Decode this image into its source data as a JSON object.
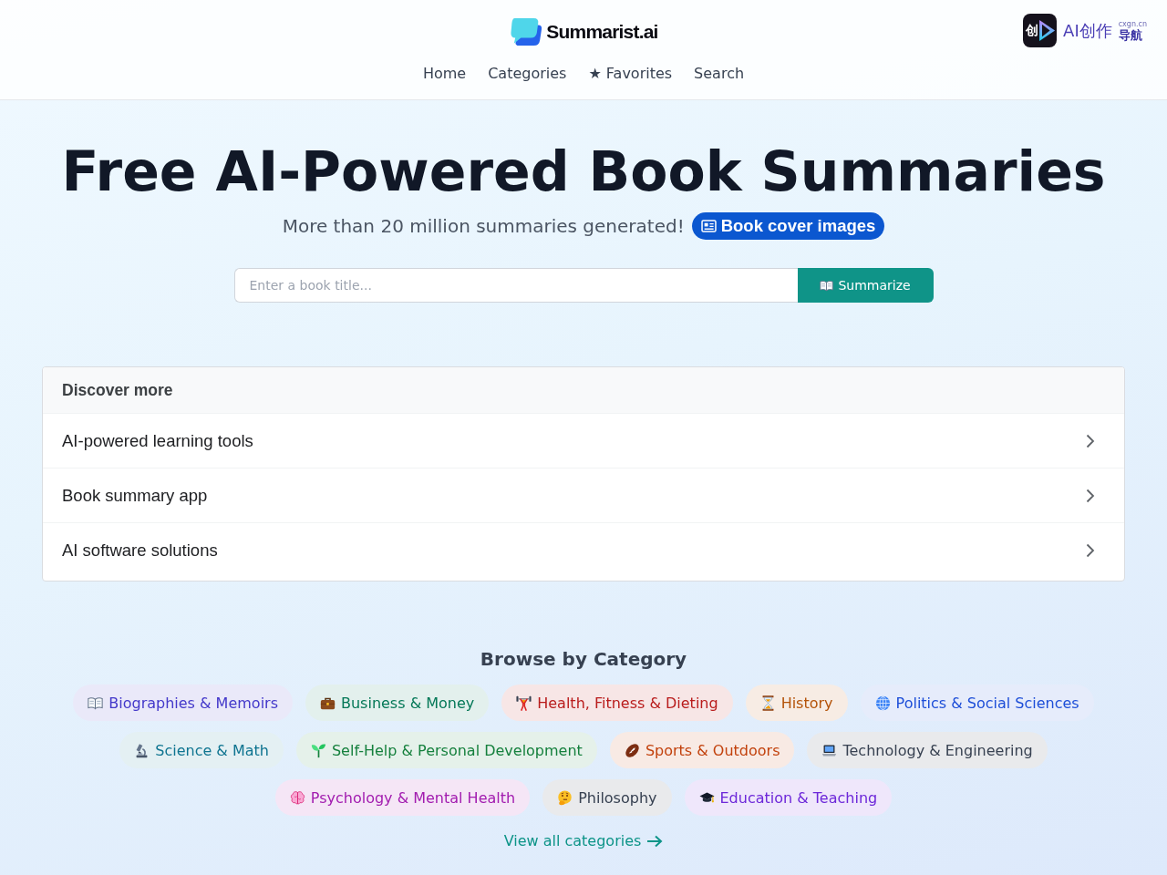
{
  "header": {
    "brand": "Summarist.ai",
    "nav": [
      {
        "label": "Home"
      },
      {
        "label": "Categories"
      },
      {
        "label": "★ Favorites"
      },
      {
        "label": "Search"
      }
    ],
    "partner_logo": {
      "tile_glyph": "创",
      "name": "AI创作",
      "domain": "cxgn.cn",
      "tagline": "导航"
    }
  },
  "hero": {
    "title": "Free AI-Powered Book Summaries",
    "subtitle": "More than 20 million summaries generated!",
    "promo_link": "Book cover images",
    "search": {
      "placeholder": "Enter a book title...",
      "button": "Summarize"
    }
  },
  "discover": {
    "title": "Discover more",
    "items": [
      {
        "label": "AI-powered learning tools"
      },
      {
        "label": "Book summary app"
      },
      {
        "label": "AI software solutions"
      }
    ]
  },
  "categories": {
    "title": "Browse by Category",
    "items": [
      {
        "label": "Biographies & Memoirs",
        "color": "#4338ca"
      },
      {
        "label": "Business & Money",
        "color": "#047857"
      },
      {
        "label": "Health, Fitness & Dieting",
        "color": "#b91c1c"
      },
      {
        "label": "History",
        "color": "#b45309"
      },
      {
        "label": "Politics & Social Sciences",
        "color": "#1d4ed8"
      },
      {
        "label": "Science & Math",
        "color": "#0e7490"
      },
      {
        "label": "Self-Help & Personal Development",
        "color": "#15803d"
      },
      {
        "label": "Sports & Outdoors",
        "color": "#c2410c"
      },
      {
        "label": "Technology & Engineering",
        "color": "#374151"
      },
      {
        "label": "Psychology & Mental Health",
        "color": "#a21caf"
      },
      {
        "label": "Philosophy",
        "color": "#374151"
      },
      {
        "label": "Education & Teaching",
        "color": "#6d28d9"
      }
    ],
    "view_all": "View all categories"
  }
}
